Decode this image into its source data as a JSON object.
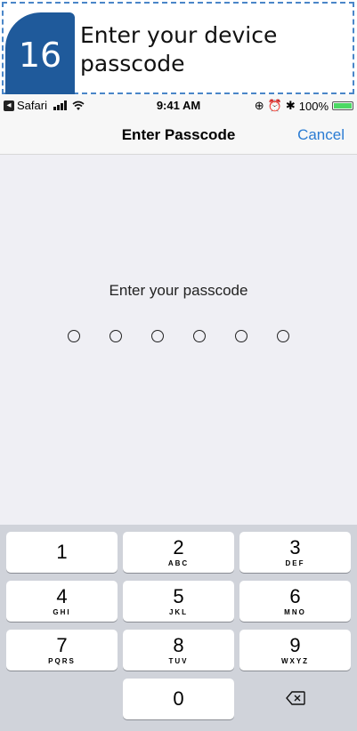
{
  "callout": {
    "step_number": "16",
    "text": "Enter your device passcode"
  },
  "status_bar": {
    "back_app": "Safari",
    "time": "9:41 AM",
    "battery": "100%"
  },
  "nav": {
    "title": "Enter Passcode",
    "cancel_label": "Cancel"
  },
  "main": {
    "prompt": "Enter your passcode",
    "passcode_length": 6
  },
  "keypad": {
    "keys": [
      {
        "digit": "1",
        "letters": ""
      },
      {
        "digit": "2",
        "letters": "ABC"
      },
      {
        "digit": "3",
        "letters": "DEF"
      },
      {
        "digit": "4",
        "letters": "GHI"
      },
      {
        "digit": "5",
        "letters": "JKL"
      },
      {
        "digit": "6",
        "letters": "MNO"
      },
      {
        "digit": "7",
        "letters": "PQRS"
      },
      {
        "digit": "8",
        "letters": "TUV"
      },
      {
        "digit": "9",
        "letters": "WXYZ"
      },
      {
        "digit": "0",
        "letters": ""
      }
    ]
  },
  "colors": {
    "accent": "#2b7cd3",
    "callout_badge": "#1f5a9b",
    "keypad_bg": "#d0d3da"
  }
}
